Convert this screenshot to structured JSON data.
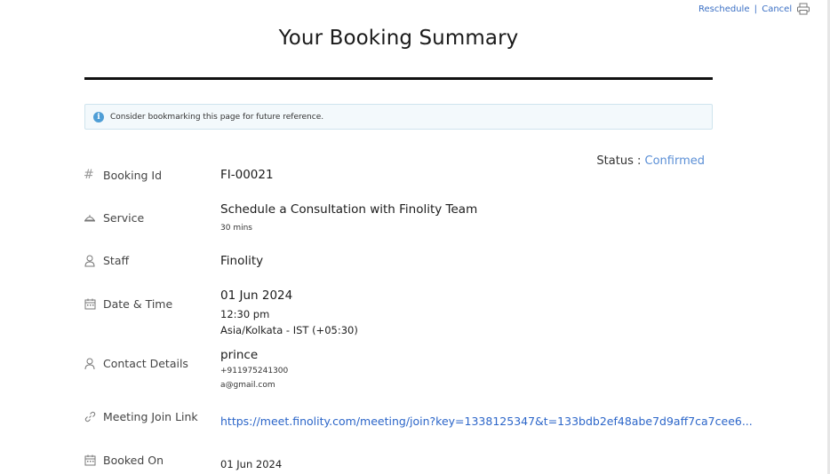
{
  "header": {
    "reschedule_label": "Reschedule",
    "separator": "|",
    "cancel_label": "Cancel",
    "title": "Your Booking Summary"
  },
  "notice": {
    "icon": "info-icon",
    "text": "Consider bookmarking this page for future reference."
  },
  "status": {
    "label": "Status :",
    "value": "Confirmed"
  },
  "rows": {
    "booking_id": {
      "label": "Booking Id",
      "icon": "hash-icon",
      "value": "FI-00021"
    },
    "service": {
      "label": "Service",
      "icon": "service-icon",
      "value": "Schedule a Consultation with Finolity Team",
      "duration": "30 mins"
    },
    "staff": {
      "label": "Staff",
      "icon": "staff-icon",
      "value": "Finolity"
    },
    "datetime": {
      "label": "Date & Time",
      "icon": "calendar-icon",
      "date": "01 Jun 2024",
      "time": "12:30 pm",
      "timezone": "Asia/Kolkata - IST (+05:30)"
    },
    "contact": {
      "label": "Contact Details",
      "icon": "user-icon",
      "name": "prince",
      "phone": "+911975241300",
      "email": "a@gmail.com"
    },
    "meeting": {
      "label": "Meeting Join Link",
      "icon": "link-icon",
      "url": "https://meet.finolity.com/meeting/join?key=1338125347&t=133bdb2ef48abe7d9aff7ca7cee6..."
    },
    "booked_on": {
      "label": "Booked On",
      "icon": "calendar-icon",
      "value": "01 Jun 2024"
    }
  },
  "colors": {
    "accent": "#2c66c9",
    "status_confirmed": "#5b8fd6",
    "notice_bg": "#f3f9fc",
    "info_icon": "#4f9ed6"
  }
}
